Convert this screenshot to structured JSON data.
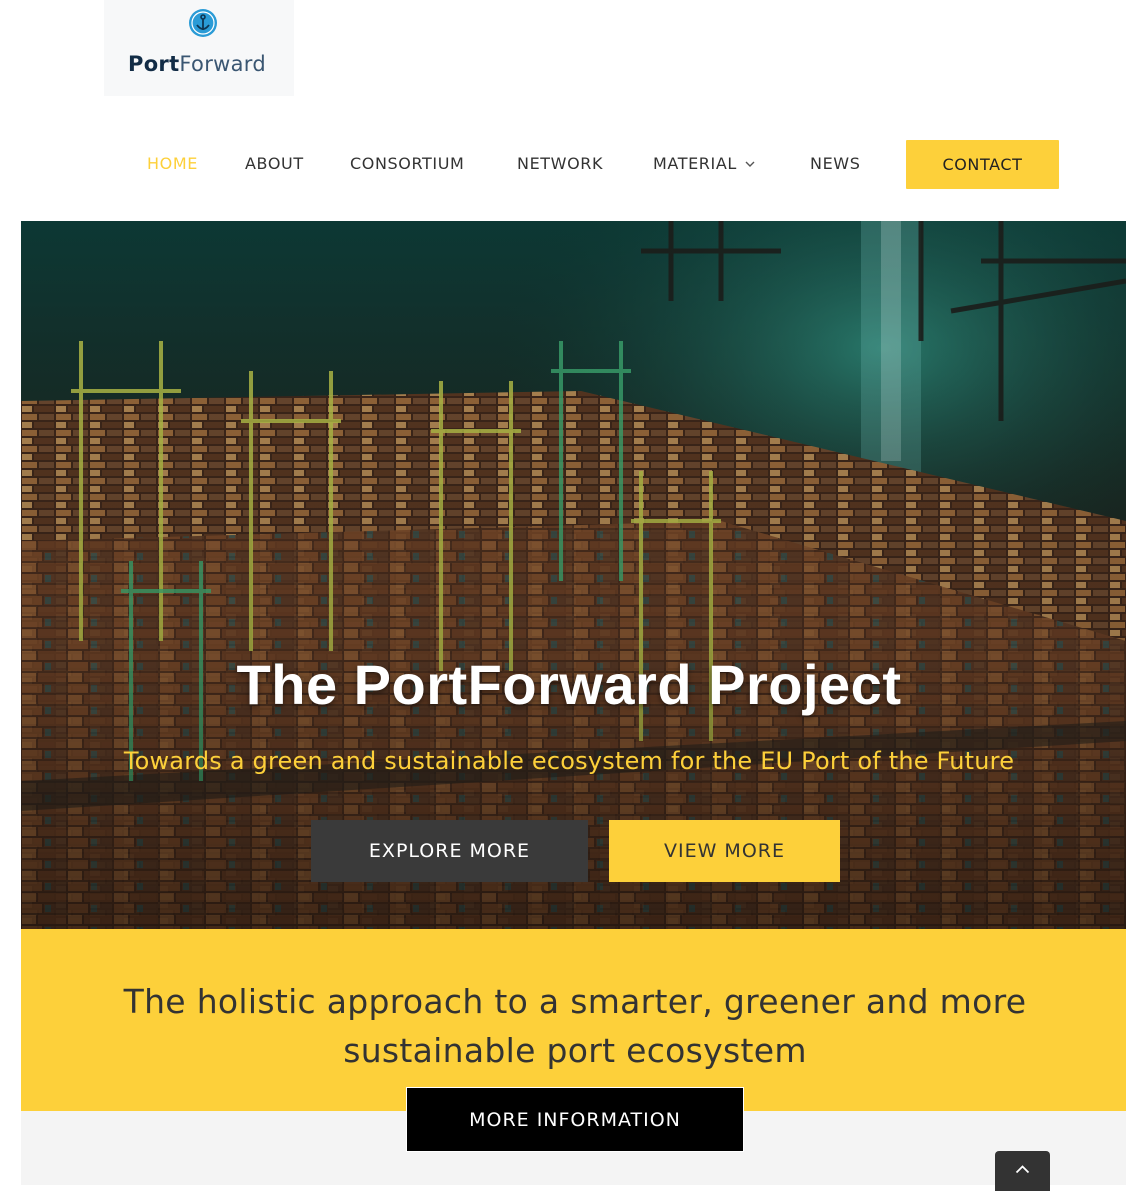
{
  "brand": {
    "name_bold": "Port",
    "name_light": "Forward",
    "accent_color": "#fdd03a",
    "logo_icon": "anchor-globe-icon"
  },
  "nav": {
    "items": [
      {
        "label": "HOME",
        "active": true
      },
      {
        "label": "ABOUT",
        "active": false
      },
      {
        "label": "CONSORTIUM",
        "active": false
      },
      {
        "label": "NETWORK",
        "active": false
      },
      {
        "label": "MATERIAL",
        "active": false,
        "has_dropdown": true
      },
      {
        "label": "NEWS",
        "active": false
      }
    ],
    "contact_label": "CONTACT"
  },
  "hero": {
    "title": "The PortForward Project",
    "subtitle": "Towards a green and sustainable ecosystem for the EU Port of the Future",
    "explore_label": "EXPLORE MORE",
    "view_label": "VIEW MORE"
  },
  "band": {
    "text_line1": "The holistic approach to a smarter, greener and more",
    "text_line2": "sustainable port ecosystem",
    "more_label": "MORE INFORMATION"
  },
  "scroll_top_icon": "chevron-up-icon"
}
